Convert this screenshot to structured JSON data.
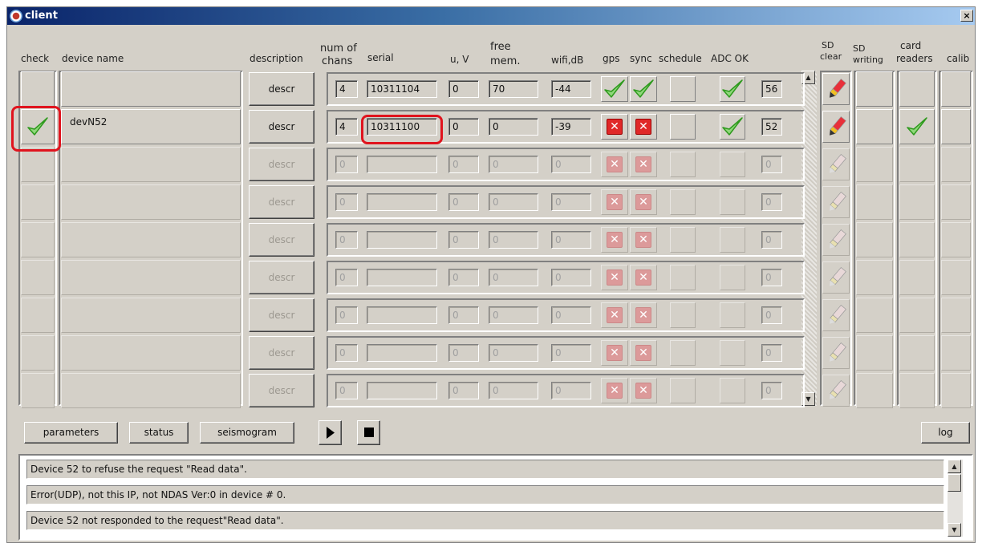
{
  "window": {
    "title": "client",
    "close_glyph": "×"
  },
  "headers": {
    "check": "check",
    "device_name": "device name",
    "description": "description",
    "num_of_chans_1": "num of",
    "num_of_chans_2": "chans",
    "serial": "serial",
    "u_v": "u, V",
    "free_mem_1": "free",
    "free_mem_2": "mem.",
    "wifi": "wifi,dB",
    "gps": "gps",
    "sync": "sync",
    "schedule": "schedule",
    "adc_ok": "ADC OK",
    "sd_clear_1": "SD",
    "sd_clear_2": "clear",
    "sd_writing_1": "SD",
    "sd_writing_2": "writing",
    "card_readers_1": "card",
    "card_readers_2": "readers",
    "calib": "calib"
  },
  "rows": [
    {
      "checked": false,
      "device": "",
      "descr": "descr",
      "active": true,
      "chans": "4",
      "serial": "10311104",
      "u": "0",
      "mem": "70",
      "wifi": "-44",
      "gps": "ok",
      "sync": "ok",
      "adc": "ok",
      "adc_val": "56",
      "card_reader": false
    },
    {
      "checked": true,
      "device": "devN52",
      "descr": "descr",
      "active": true,
      "chans": "4",
      "serial": "10311100",
      "u": "0",
      "mem": "0",
      "wifi": "-39",
      "gps": "x",
      "sync": "x",
      "adc": "ok",
      "adc_val": "52",
      "card_reader": true
    },
    {
      "checked": false,
      "device": "",
      "descr": "descr",
      "active": false,
      "chans": "0",
      "serial": "",
      "u": "0",
      "mem": "0",
      "wifi": "0",
      "gps": "x",
      "sync": "x",
      "adc": "",
      "adc_val": "0",
      "card_reader": false
    },
    {
      "checked": false,
      "device": "",
      "descr": "descr",
      "active": false,
      "chans": "0",
      "serial": "",
      "u": "0",
      "mem": "0",
      "wifi": "0",
      "gps": "x",
      "sync": "x",
      "adc": "",
      "adc_val": "0",
      "card_reader": false
    },
    {
      "checked": false,
      "device": "",
      "descr": "descr",
      "active": false,
      "chans": "0",
      "serial": "",
      "u": "0",
      "mem": "0",
      "wifi": "0",
      "gps": "x",
      "sync": "x",
      "adc": "",
      "adc_val": "0",
      "card_reader": false
    },
    {
      "checked": false,
      "device": "",
      "descr": "descr",
      "active": false,
      "chans": "0",
      "serial": "",
      "u": "0",
      "mem": "0",
      "wifi": "0",
      "gps": "x",
      "sync": "x",
      "adc": "",
      "adc_val": "0",
      "card_reader": false
    },
    {
      "checked": false,
      "device": "",
      "descr": "descr",
      "active": false,
      "chans": "0",
      "serial": "",
      "u": "0",
      "mem": "0",
      "wifi": "0",
      "gps": "x",
      "sync": "x",
      "adc": "",
      "adc_val": "0",
      "card_reader": false
    },
    {
      "checked": false,
      "device": "",
      "descr": "descr",
      "active": false,
      "chans": "0",
      "serial": "",
      "u": "0",
      "mem": "0",
      "wifi": "0",
      "gps": "x",
      "sync": "x",
      "adc": "",
      "adc_val": "0",
      "card_reader": false
    },
    {
      "checked": false,
      "device": "",
      "descr": "descr",
      "active": false,
      "chans": "0",
      "serial": "",
      "u": "0",
      "mem": "0",
      "wifi": "0",
      "gps": "x",
      "sync": "x",
      "adc": "",
      "adc_val": "0",
      "card_reader": false
    }
  ],
  "toolbar": {
    "parameters": "parameters",
    "status": "status",
    "seismogram": "seismogram",
    "play_icon": "play-icon",
    "stop_icon": "stop-icon",
    "log": "log"
  },
  "log_lines": [
    "Device 52 to refuse the request \"Read data\".",
    "Error(UDP), not this IP, not NDAS Ver:0 in device # 0.",
    "Device 52 not responded to the request\"Read data\"."
  ],
  "colors": {
    "highlight": "#e0141e",
    "error": "#e02828",
    "ok": "#3cb028",
    "title_bar": "#0a246a"
  }
}
